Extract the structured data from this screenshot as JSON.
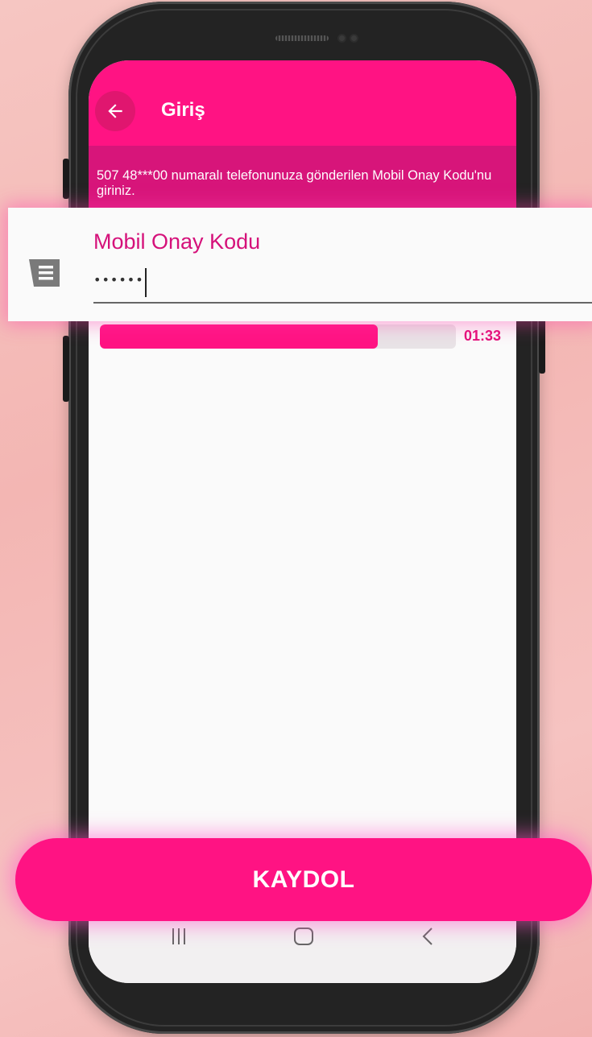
{
  "appbar": {
    "title": "Giriş"
  },
  "info": {
    "message": "507 48***00 numaralı telefonunuza gönderilen Mobil Onay Kodu'nu giriniz."
  },
  "otp": {
    "label": "Mobil Onay Kodu",
    "value": "••••••"
  },
  "timer": {
    "remaining": "01:33",
    "progress_fraction": 0.78
  },
  "primary_button": {
    "label": "KAYDOL"
  },
  "icons": {
    "back": "arrow-left-icon",
    "sms": "message-icon",
    "nav_recent": "recent-apps-icon",
    "nav_home": "home-icon",
    "nav_back": "chevron-left-icon"
  },
  "colors": {
    "accent": "#ff1383",
    "accent_dark": "#d7157a",
    "label": "#d5117a"
  }
}
